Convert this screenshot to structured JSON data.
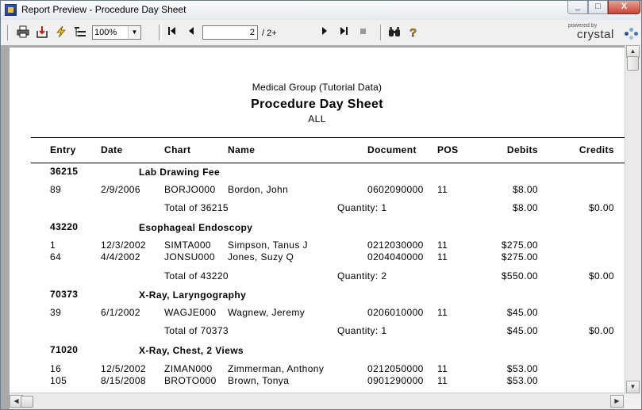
{
  "window": {
    "title": "Report Preview - Procedure Day Sheet",
    "min_label": "_",
    "max_label": "□",
    "close_label": "X"
  },
  "toolbar": {
    "zoom_value": "100%",
    "page_value": "2",
    "page_total": "/ 2+",
    "brand_powered": "powered by",
    "brand_name": "crystal"
  },
  "report": {
    "org": "Medical Group (Tutorial Data)",
    "title": "Procedure Day Sheet",
    "filter": "ALL",
    "columns": {
      "entry": "Entry",
      "date": "Date",
      "chart": "Chart",
      "name": "Name",
      "document": "Document",
      "pos": "POS",
      "debits": "Debits",
      "credits": "Credits"
    },
    "groups": [
      {
        "code": "36215",
        "description": "Lab Drawing Fee",
        "rows": [
          {
            "entry": "89",
            "date": "2/9/2006",
            "chart": "BORJO000",
            "name": "Bordon, John",
            "document": "0602090000",
            "pos": "11",
            "debit": "$8.00"
          }
        ],
        "total_label": "Total of 36215",
        "quantity": "Quantity: 1",
        "total_debit": "$8.00",
        "total_credit": "$0.00"
      },
      {
        "code": "43220",
        "description": "Esophageal Endoscopy",
        "rows": [
          {
            "entry": "1",
            "date": "12/3/2002",
            "chart": "SIMTA000",
            "name": "Simpson, Tanus J",
            "document": "0212030000",
            "pos": "11",
            "debit": "$275.00"
          },
          {
            "entry": "64",
            "date": "4/4/2002",
            "chart": "JONSU000",
            "name": "Jones, Suzy Q",
            "document": "0204040000",
            "pos": "11",
            "debit": "$275.00"
          }
        ],
        "total_label": "Total of 43220",
        "quantity": "Quantity: 2",
        "total_debit": "$550.00",
        "total_credit": "$0.00"
      },
      {
        "code": "70373",
        "description": "X-Ray, Laryngography",
        "rows": [
          {
            "entry": "39",
            "date": "6/1/2002",
            "chart": "WAGJE000",
            "name": "Wagnew, Jeremy",
            "document": "0206010000",
            "pos": "11",
            "debit": "$45.00"
          }
        ],
        "total_label": "Total of 70373",
        "quantity": "Quantity: 1",
        "total_debit": "$45.00",
        "total_credit": "$0.00"
      },
      {
        "code": "71020",
        "description": "X-Ray, Chest, 2 Views",
        "rows": [
          {
            "entry": "16",
            "date": "12/5/2002",
            "chart": "ZIMAN000",
            "name": "Zimmerman, Anthony",
            "document": "0212050000",
            "pos": "11",
            "debit": "$53.00"
          },
          {
            "entry": "105",
            "date": "8/15/2008",
            "chart": "BROTO000",
            "name": "Brown, Tonya",
            "document": "0901290000",
            "pos": "11",
            "debit": "$53.00"
          }
        ]
      }
    ]
  }
}
